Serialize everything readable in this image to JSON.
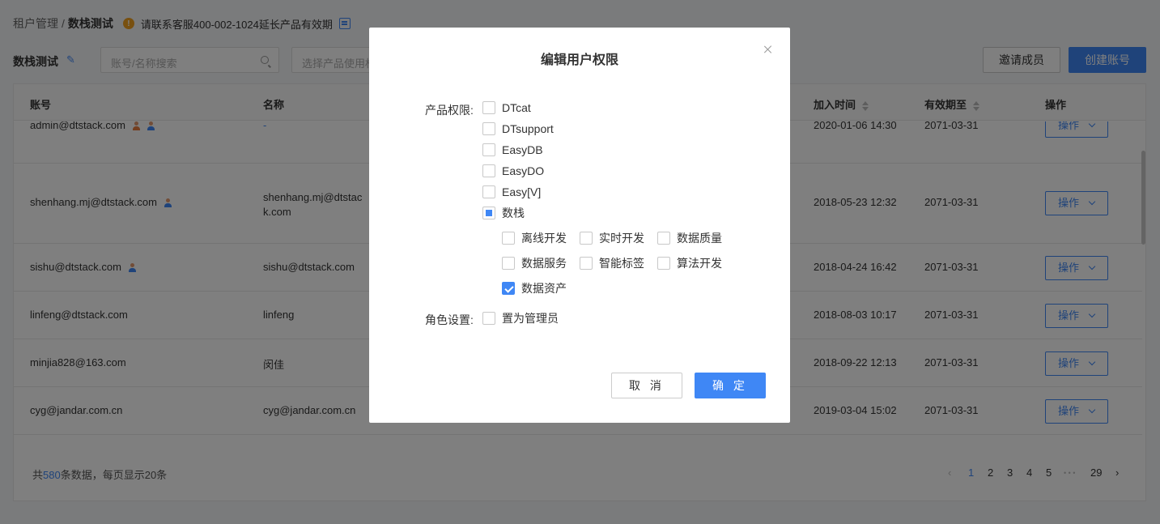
{
  "breadcrumb": {
    "parent": "租户管理",
    "separator": "/",
    "current": "数栈测试"
  },
  "notice": {
    "icon": "warning-icon",
    "text": "请联系客服400-002-1024延长产品有效期",
    "link_icon": "document-icon"
  },
  "toolbar": {
    "tenant_name": "数栈测试",
    "search_placeholder": "账号/名称搜索",
    "product_select_placeholder": "选择产品使用权",
    "invite_label": "邀请成员",
    "create_label": "创建账号"
  },
  "table": {
    "columns": {
      "account": "账号",
      "name": "名称",
      "join_time": "加入时间",
      "expire": "有效期至",
      "action": "操作"
    },
    "rows": [
      {
        "account": "admin@dtstack.com",
        "name": "-",
        "join_time": "2020-01-06 14:30",
        "expire": "2071-03-31",
        "action": "操作"
      },
      {
        "account": "shenhang.mj@dtstack.com",
        "name_line1": "shenhang.mj@dtstac",
        "name_line2": "k.com",
        "join_time": "2018-05-23 12:32",
        "expire": "2071-03-31",
        "action": "操作"
      },
      {
        "account": "sishu@dtstack.com",
        "name": "sishu@dtstack.com",
        "join_time": "2018-04-24 16:42",
        "expire": "2071-03-31",
        "action": "操作"
      },
      {
        "account": "linfeng@dtstack.com",
        "name": "linfeng",
        "join_time": "2018-08-03 10:17",
        "expire": "2071-03-31",
        "action": "操作"
      },
      {
        "account": "minjia828@163.com",
        "name": "闵佳",
        "join_time": "2018-09-22 12:13",
        "expire": "2071-03-31",
        "action": "操作"
      },
      {
        "account": "cyg@jandar.com.cn",
        "name": "cyg@jandar.com.cn",
        "join_time": "2019-03-04 15:02",
        "expire": "2071-03-31",
        "action": "操作"
      }
    ]
  },
  "footer": {
    "total_prefix": "共",
    "total_count": "580",
    "total_suffix": "条数据，每页显示20条"
  },
  "pagination": {
    "pages": [
      "1",
      "2",
      "3",
      "4",
      "5"
    ],
    "ellipsis": "• • •",
    "last": "29",
    "current": "1"
  },
  "modal": {
    "title": "编辑用户权限",
    "product_label": "产品权限:",
    "products": [
      {
        "label": "DTcat",
        "state": "unchecked"
      },
      {
        "label": "DTsupport",
        "state": "unchecked"
      },
      {
        "label": "EasyDB",
        "state": "unchecked"
      },
      {
        "label": "EasyDO",
        "state": "unchecked"
      },
      {
        "label": "Easy[V]",
        "state": "unchecked"
      },
      {
        "label": "数栈",
        "state": "partial"
      }
    ],
    "sub_products": [
      {
        "label": "离线开发",
        "state": "unchecked"
      },
      {
        "label": "实时开发",
        "state": "unchecked"
      },
      {
        "label": "数据质量",
        "state": "unchecked"
      },
      {
        "label": "数据服务",
        "state": "unchecked"
      },
      {
        "label": "智能标签",
        "state": "unchecked"
      },
      {
        "label": "算法开发",
        "state": "unchecked"
      },
      {
        "label": "数据资产",
        "state": "checked"
      }
    ],
    "role_label": "角色设置:",
    "role_option": {
      "label": "置为管理员",
      "state": "unchecked"
    },
    "cancel_label": "取 消",
    "ok_label": "确 定"
  },
  "colors": {
    "primary": "#3f87f5",
    "warning": "#f0a020",
    "mask": "rgba(0,0,0,0.5)"
  }
}
